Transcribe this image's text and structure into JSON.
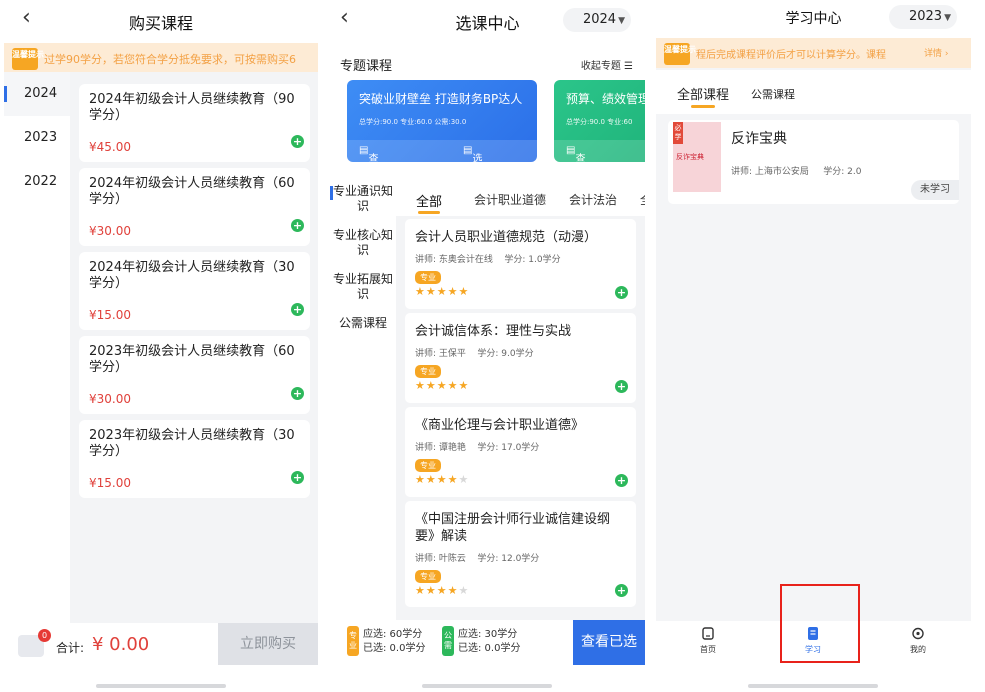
{
  "screen1": {
    "title": "购买课程",
    "back_icon": "‹",
    "notice_tag": "温馨提示",
    "notice_text": "过学90学分，若您符合学分抵免要求，可按需购买6",
    "years": [
      "2024",
      "2023",
      "2022"
    ],
    "products": [
      {
        "title": "2024年初级会计人员继续教育（90学分）",
        "price": "¥45.00"
      },
      {
        "title": "2024年初级会计人员继续教育（60学分）",
        "price": "¥30.00"
      },
      {
        "title": "2024年初级会计人员继续教育（30学分）",
        "price": "¥15.00"
      },
      {
        "title": "2023年初级会计人员继续教育（60学分）",
        "price": "¥30.00"
      },
      {
        "title": "2023年初级会计人员继续教育（30学分）",
        "price": "¥15.00"
      }
    ],
    "cart_badge": "0",
    "total_label": "合计:",
    "total_amount": "¥ 0.00",
    "buy_button": "立即购买"
  },
  "screen2": {
    "title": "选课中心",
    "back_icon": "‹",
    "year": "2024",
    "section_title": "专题课程",
    "collapse_label": "收起专题 ☰",
    "topics": [
      {
        "title": "突破业财壁垒 打造财务BP达人",
        "stats": "总学分:90.0 专业:60.0 公需:30.0",
        "view": "查看",
        "select": "选择专题"
      },
      {
        "title": "预算、绩效管理",
        "stats": "总学分:90.0 专业:60",
        "view": "查看"
      }
    ],
    "categories": [
      "专业通识知识",
      "专业核心知识",
      "专业拓展知识",
      "公需课程"
    ],
    "tabs": [
      "全部",
      "会计职业道德",
      "会计法治",
      "全"
    ],
    "courses": [
      {
        "title": "会计人员职业道德规范（动漫）",
        "teacher": "讲师: 东奥会计在线",
        "credit": "学分: 1.0学分",
        "tag": "专业",
        "rating": 5
      },
      {
        "title": "会计诚信体系：理性与实战",
        "teacher": "讲师: 王保平",
        "credit": "学分: 9.0学分",
        "tag": "专业",
        "rating": 5
      },
      {
        "title": "《商业伦理与会计职业道德》",
        "teacher": "讲师: 谭艳艳",
        "credit": "学分: 17.0学分",
        "tag": "专业",
        "rating": 4
      },
      {
        "title": "《中国注册会计师行业诚信建设纲要》解读",
        "teacher": "讲师: 叶陈云",
        "credit": "学分: 12.0学分",
        "tag": "专业",
        "rating": 4
      }
    ],
    "footer": {
      "prof_tag": "专业",
      "prof_required": "应选:  60学分",
      "prof_selected": "已选:  0.0学分",
      "pub_tag": "公需",
      "pub_required": "应选:  30学分",
      "pub_selected": "已选:  0.0学分",
      "view_button": "查看已选"
    }
  },
  "screen3": {
    "title": "学习中心",
    "year": "2023",
    "notice_tag": "温馨提示",
    "notice_text": "程后完成课程评价后才可以计算学分。课程",
    "notice_link": "详情 ›",
    "tabs": [
      "全部课程",
      "公需课程"
    ],
    "course": {
      "badge": "必学",
      "cover_text": "反诈宝典",
      "title": "反诈宝典",
      "teacher": "讲师:  上海市公安局",
      "credit": "学分:  2.0",
      "status": "未学习"
    },
    "tabbar": [
      "首页",
      "学习",
      "我的"
    ]
  },
  "colors": {
    "accent": "#2f6fe6",
    "price": "#e0413b",
    "orange": "#f6a623",
    "green": "#2db85b",
    "highlight": "#e8221b"
  }
}
